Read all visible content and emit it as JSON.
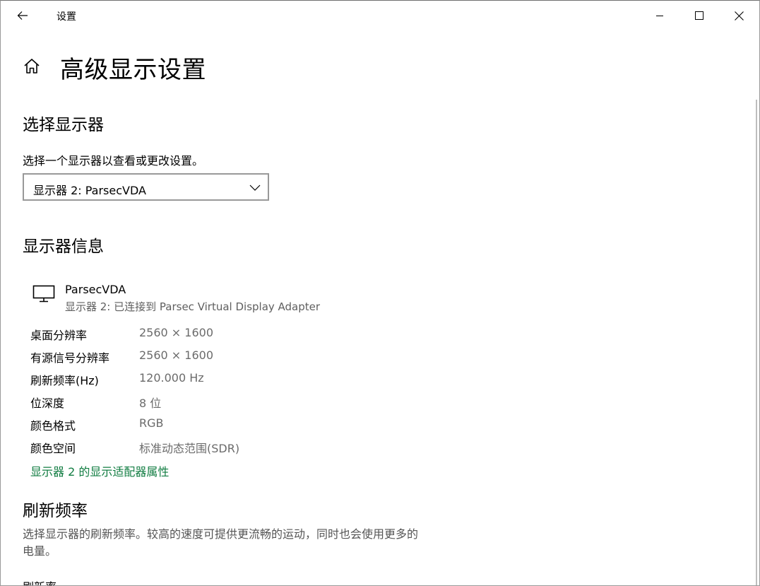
{
  "window": {
    "title": "设置"
  },
  "header": {
    "title": "高级显示设置"
  },
  "select_display": {
    "heading": "选择显示器",
    "description": "选择一个显示器以查看或更改设置。",
    "selected": "显示器 2: ParsecVDA"
  },
  "display_info": {
    "heading": "显示器信息",
    "monitor_name": "ParsecVDA",
    "monitor_detail": "显示器 2: 已连接到 Parsec Virtual Display Adapter",
    "rows": [
      {
        "label": "桌面分辨率",
        "value": "2560 × 1600"
      },
      {
        "label": "有源信号分辨率",
        "value": "2560 × 1600"
      },
      {
        "label": "刷新频率(Hz)",
        "value": "120.000 Hz"
      },
      {
        "label": "位深度",
        "value": "8 位"
      },
      {
        "label": "颜色格式",
        "value": "RGB"
      },
      {
        "label": "颜色空间",
        "value": "标准动态范围(SDR)"
      }
    ],
    "adapter_link": "显示器 2 的显示适配器属性"
  },
  "refresh_rate": {
    "heading": "刷新频率",
    "description": "选择显示器的刷新频率。较高的速度可提供更流畅的运动，同时也会使用更多的电量。",
    "field_label": "刷新率"
  },
  "colors": {
    "link": "#107c41",
    "secondary_text": "#6b6b6b"
  },
  "icons": [
    "back-arrow-icon",
    "minimize-icon",
    "maximize-icon",
    "close-icon",
    "home-icon",
    "chevron-down-icon",
    "monitor-icon"
  ]
}
